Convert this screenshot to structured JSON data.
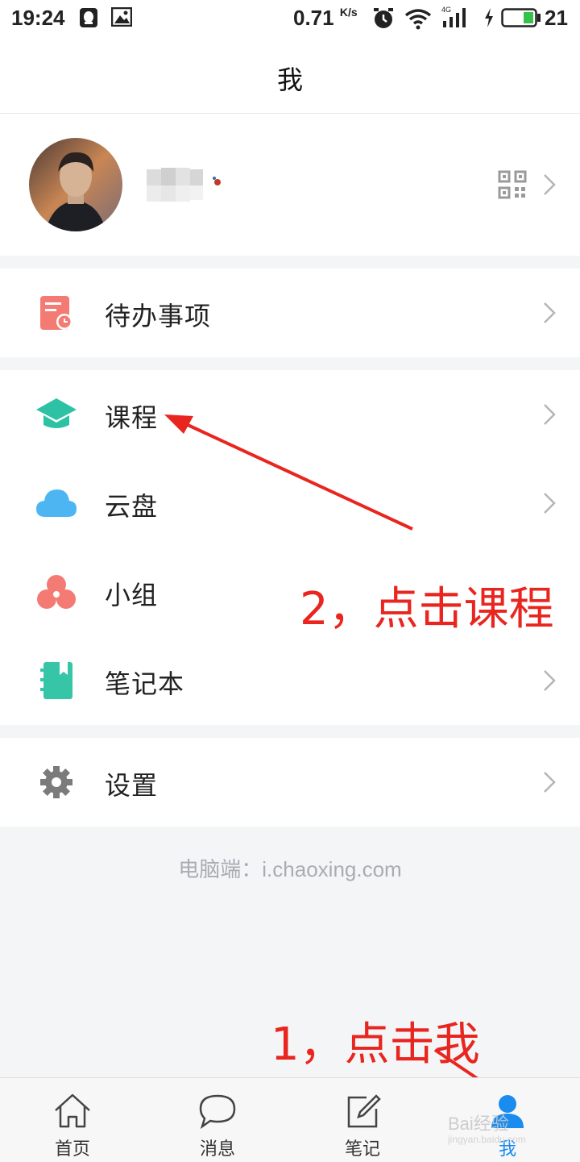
{
  "status_bar": {
    "time": "19:24",
    "speed_value": "0.71",
    "speed_unit": "K/s",
    "network": "4G",
    "battery": "21"
  },
  "header": {
    "title": "我"
  },
  "profile": {
    "avatar_alt": "avatar",
    "qr_icon": "qr-code-icon"
  },
  "menu": {
    "todo": {
      "label": "待办事项",
      "icon": "todo-icon",
      "color": "#f47b73"
    },
    "course": {
      "label": "课程",
      "icon": "graduation-cap-icon",
      "color": "#2ec2a5"
    },
    "cloud": {
      "label": "云盘",
      "icon": "cloud-icon",
      "color": "#4db6f2"
    },
    "group": {
      "label": "小组",
      "icon": "group-icon",
      "color": "#f47b73"
    },
    "notebook": {
      "label": "笔记本",
      "icon": "notebook-icon",
      "color": "#37c5a8"
    },
    "settings": {
      "label": "设置",
      "icon": "gear-icon",
      "color": "#7b7b7b"
    }
  },
  "footer_link": "电脑端：i.chaoxing.com",
  "annotations": {
    "step2": "2，点击课程",
    "step1": "1，点击我"
  },
  "tabbar": {
    "home": "首页",
    "messages": "消息",
    "notes": "笔记",
    "me": "我",
    "active_color": "#1a8cf0"
  },
  "watermark": {
    "brand": "Bai经验",
    "url": "jingyan.baidu.com"
  }
}
